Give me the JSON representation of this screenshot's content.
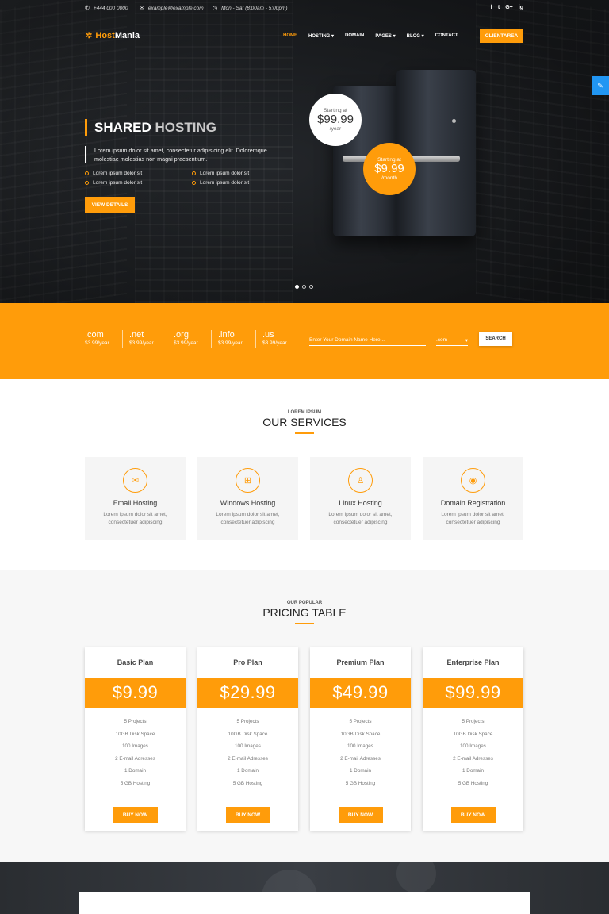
{
  "topbar": {
    "phone": "+444 000 0000",
    "email": "example@example.com",
    "hours": "Mon - Sat (8:00am - 5:00pm)",
    "social": [
      "f",
      "t",
      "G+",
      "ig"
    ]
  },
  "brand": {
    "part1": "Host",
    "part2": "Mania"
  },
  "nav": {
    "items": [
      "HOME",
      "HOSTING",
      "DOMAIN",
      "PAGES",
      "BLOG",
      "CONTACT"
    ],
    "client_area": "CLIENTAREA"
  },
  "hero": {
    "title_main": "SHARED",
    "title_dim": "HOSTING",
    "description": "Lorem ipsum dolor sit amet, consectetur adipisicing elit. Doloremque molestiae molestias non magni praesentium.",
    "bullets": [
      "Lorem ipsum dolor sit",
      "Lorem ipsum dolor sit",
      "Lorem ipsum dolor sit",
      "Lorem ipsum dolor sit"
    ],
    "cta": "VIEW DETAILS",
    "price_white": {
      "starting": "Starting at",
      "price": "$99.99",
      "unit": "/year"
    },
    "price_orange": {
      "starting": "Starting at",
      "price": "$9.99",
      "unit": "/month"
    }
  },
  "domain": {
    "tlds": [
      {
        "name": ".com",
        "price": "$3.99/year"
      },
      {
        "name": ".net",
        "price": "$3.99/year"
      },
      {
        "name": ".org",
        "price": "$3.99/year"
      },
      {
        "name": ".info",
        "price": "$3.99/year"
      },
      {
        "name": ".us",
        "price": "$3.99/year"
      }
    ],
    "placeholder": "Enter Your Domain Name Here...",
    "selected_tld": ".com",
    "search": "SEARCH"
  },
  "services": {
    "subtitle": "LOREM IPSUM",
    "title": "OUR SERVICES",
    "items": [
      {
        "title": "Email Hosting",
        "desc": "Lorem ipsum dolor sit amet, consectetuer adipiscing",
        "icon": "envelope-icon"
      },
      {
        "title": "Windows Hosting",
        "desc": "Lorem ipsum dolor sit amet, consectetuer adipiscing",
        "icon": "windows-icon"
      },
      {
        "title": "Linux Hosting",
        "desc": "Lorem ipsum dolor sit amet, consectetuer adipiscing",
        "icon": "linux-icon"
      },
      {
        "title": "Domain Registration",
        "desc": "Lorem ipsum dolor sit amet, consectetuer adipiscing",
        "icon": "globe-icon"
      }
    ]
  },
  "pricing": {
    "subtitle": "OUR POPULAR",
    "title": "PRICING TABLE",
    "plans": [
      {
        "name": "Basic Plan",
        "price": "$9.99",
        "features": [
          "5 Projects",
          "10GB Disk Space",
          "100 Images",
          "2 E-mail Adresses",
          "1 Domain",
          "5 GB Hosting"
        ],
        "cta": "BUY NOW"
      },
      {
        "name": "Pro Plan",
        "price": "$29.99",
        "features": [
          "5 Projects",
          "10GB Disk Space",
          "100 Images",
          "2 E-mail Adresses",
          "1 Domain",
          "5 GB Hosting"
        ],
        "cta": "BUY NOW"
      },
      {
        "name": "Premium Plan",
        "price": "$49.99",
        "features": [
          "5 Projects",
          "10GB Disk Space",
          "100 Images",
          "2 E-mail Adresses",
          "1 Domain",
          "5 GB Hosting"
        ],
        "cta": "BUY NOW"
      },
      {
        "name": "Enterprise Plan",
        "price": "$99.99",
        "features": [
          "5 Projects",
          "10GB Disk Space",
          "100 Images",
          "2 E-mail Adresses",
          "1 Domain",
          "5 GB Hosting"
        ],
        "cta": "BUY NOW"
      }
    ]
  },
  "colors": {
    "accent": "#ff9c0a",
    "side_tab": "#2196f3"
  }
}
